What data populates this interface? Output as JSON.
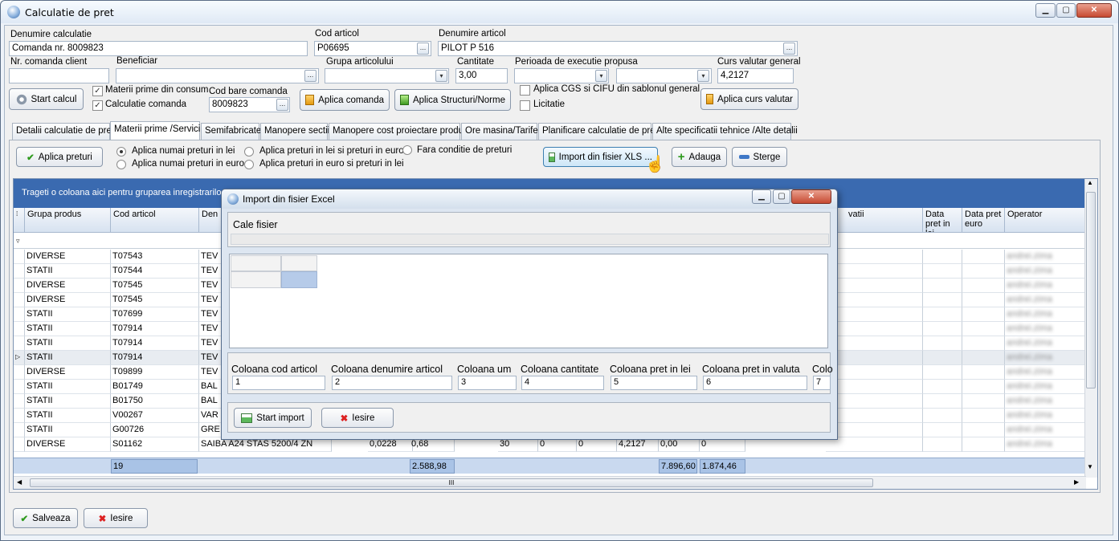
{
  "window": {
    "title": "Calculatie de pret"
  },
  "form": {
    "denumire_calculatie_label": "Denumire calculatie",
    "denumire_calculatie_value": "Comanda nr. 8009823",
    "cod_articol_label": "Cod articol",
    "cod_articol_value": "P06695",
    "denumire_articol_label": "Denumire articol",
    "denumire_articol_value": "PILOT P 516",
    "nr_comanda_label": "Nr. comanda client",
    "nr_comanda_value": "",
    "beneficiar_label": "Beneficiar",
    "beneficiar_value": "",
    "grupa_label": "Grupa articolului",
    "grupa_value": "",
    "cantitate_label": "Cantitate",
    "cantitate_value": "3,00",
    "perioada_label": "Perioada de executie propusa",
    "curs_label": "Curs valutar general",
    "curs_value": "4,2127",
    "start_calcul": "Start calcul",
    "materii_prime_chk": "Materii prime din consum",
    "calculatie_chk": "Calculatie comanda",
    "cod_bare_label": "Cod bare comanda",
    "cod_bare_value": "8009823",
    "aplica_comanda": "Aplica comanda",
    "aplica_structuri": "Aplica Structuri/Norme",
    "aplica_cgs": "Aplica CGS si CIFU din sablonul general",
    "licitatie": "Licitatie",
    "aplica_curs": "Aplica curs valutar",
    "ellipsis": "...",
    "check_mark": "✓",
    "dd_arrow": "▾"
  },
  "tabs": [
    "Detalii calculatie de pret",
    "Materii prime /Servicii",
    "Semifabricate",
    "Manopere sectii",
    "Manopere cost proiectare produs",
    "Ore masina/Tarife",
    "Planificare calculatie de pret",
    "Alte specificatii tehnice /Alte detalii"
  ],
  "toolbar": {
    "aplica_preturi": "Aplica preturi",
    "radio1": "Aplica numai preturi in lei",
    "radio2": "Aplica numai preturi in euro",
    "radio3": "Aplica preturi in lei si preturi in euro",
    "radio4": "Aplica preturi in euro si preturi in lei",
    "radio5": "Fara conditie de preturi",
    "import_xls": "Import din fisier XLS ...",
    "adauga": "Adauga",
    "sterge": "Sterge"
  },
  "grid": {
    "group_hint": "Trageti o coloana aici pentru gruparea inregistrarilor d",
    "headers": {
      "grupa": "Grupa produs",
      "cod": "Cod articol",
      "den": "Den",
      "vati": "vatii",
      "data_lei": "Data pret in lei",
      "data_euro": "Data pret euro",
      "operator": "Operator"
    },
    "rows": [
      {
        "grupa": "DIVERSE",
        "cod": "T07543",
        "den": "TEV"
      },
      {
        "grupa": "STATII",
        "cod": "T07544",
        "den": "TEV"
      },
      {
        "grupa": "DIVERSE",
        "cod": "T07545",
        "den": "TEV"
      },
      {
        "grupa": "DIVERSE",
        "cod": "T07545",
        "den": "TEV"
      },
      {
        "grupa": "STATII",
        "cod": "T07699",
        "den": "TEV"
      },
      {
        "grupa": "STATII",
        "cod": "T07914",
        "den": "TEV"
      },
      {
        "grupa": "STATII",
        "cod": "T07914",
        "den": "TEV"
      },
      {
        "grupa": "STATII",
        "cod": "T07914",
        "den": "TEV"
      },
      {
        "grupa": "DIVERSE",
        "cod": "T09899",
        "den": "TEV"
      },
      {
        "grupa": "STATII",
        "cod": "B01749",
        "den": "BAL"
      },
      {
        "grupa": "STATII",
        "cod": "B01750",
        "den": "BAL"
      },
      {
        "grupa": "STATII",
        "cod": "V00267",
        "den": "VAR"
      },
      {
        "grupa": "STATII",
        "cod": "G00726",
        "den": "GRE"
      },
      {
        "grupa": "DIVERSE",
        "cod": "S01162",
        "den": "SAIBA A24 STAS 5200/4 ZN"
      }
    ],
    "last_row_extra": {
      "c1": "0,0228",
      "c2": "0,68",
      "c3": "30",
      "c4": "0",
      "c5": "0",
      "c6": "4,2127",
      "c7": "0,00",
      "c8": "0"
    },
    "operator_blur": "andrei.zima",
    "summary": {
      "count": "19",
      "total1": "2.588,98",
      "total2": "7.896,60",
      "total3": "1.874,46"
    },
    "scroll_center": "III"
  },
  "dialog": {
    "title": "Import din fisier Excel",
    "cale_label": "Cale fisier",
    "cols": [
      {
        "label": "Coloana cod articol",
        "value": "1"
      },
      {
        "label": "Coloana denumire articol",
        "value": "2"
      },
      {
        "label": "Coloana um",
        "value": "3"
      },
      {
        "label": "Coloana cantitate",
        "value": "4"
      },
      {
        "label": "Coloana pret in lei",
        "value": "5"
      },
      {
        "label": "Coloana pret in valuta",
        "value": "6"
      },
      {
        "label": "Colo",
        "value": "7"
      }
    ],
    "start_import": "Start import",
    "iesire": "Iesire"
  },
  "footer": {
    "salveaza": "Salveaza",
    "iesire": "Iesire"
  }
}
